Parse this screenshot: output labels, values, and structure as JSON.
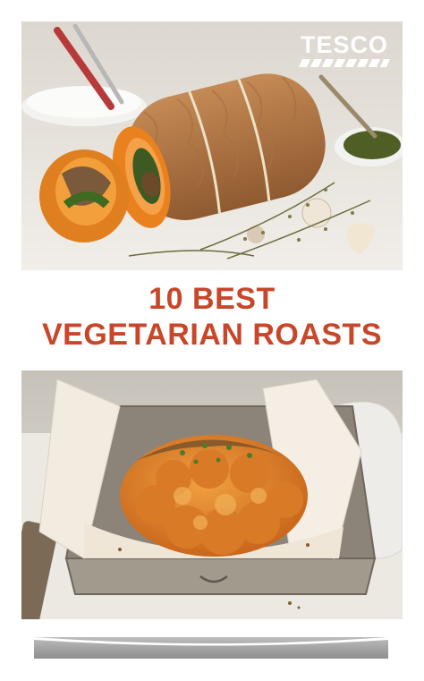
{
  "brand": {
    "logo_text": "TESCO"
  },
  "headline": {
    "line1": "10 BEST",
    "line2": "VEGETARIAN ROASTS"
  },
  "photos": {
    "top": {
      "subject": "stuffed squash roast tied with string"
    },
    "bottom": {
      "subject": "whole roasted spiced cauliflower in a tin"
    }
  },
  "colors": {
    "headline": "#c8472a",
    "squash": "#e9821e",
    "cauliflower": "#e2882c"
  }
}
